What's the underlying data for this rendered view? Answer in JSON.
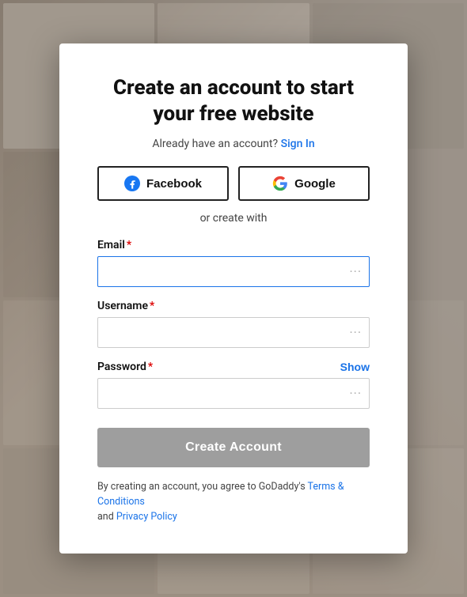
{
  "modal": {
    "title": "Create an account to start your free website",
    "signin_text": "Already have an account?",
    "signin_link": "Sign In",
    "facebook_label": "Facebook",
    "google_label": "Google",
    "or_text": "or create with",
    "email_label": "Email",
    "email_required": "*",
    "username_label": "Username",
    "username_required": "*",
    "password_label": "Password",
    "password_required": "*",
    "show_label": "Show",
    "create_btn_label": "Create Account",
    "terms_prefix": "By creating an account, you agree to GoDaddy's",
    "terms_link": "Terms & Conditions",
    "terms_mid": "and",
    "privacy_link": "Privacy Policy"
  },
  "colors": {
    "link": "#1a73e8",
    "button_disabled": "#9e9e9e"
  }
}
